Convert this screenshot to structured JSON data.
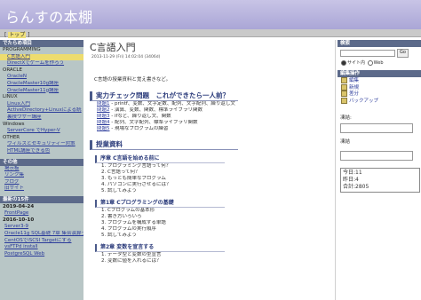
{
  "site": {
    "title": "らんすの本棚"
  },
  "topnav": {
    "home": "トップ"
  },
  "left": {
    "categories_head": "でたらめ項目",
    "categories": [
      {
        "label": "PROGRAMMING",
        "type": "cat"
      },
      {
        "label": "C言語入門",
        "type": "sub",
        "selected": true
      },
      {
        "label": "DirectXでゲームを作ろう",
        "type": "sub"
      },
      {
        "label": "ORACLE",
        "type": "cat"
      },
      {
        "label": "OracleN",
        "type": "sub"
      },
      {
        "label": "OracleMaster10g講座",
        "type": "sub"
      },
      {
        "label": "OracleMaster11g講座",
        "type": "sub"
      },
      {
        "label": "LINUX",
        "type": "cat"
      },
      {
        "label": "Linux入門",
        "type": "sub"
      },
      {
        "label": "ActiveDirectory+Linuxによる統",
        "type": "sub"
      },
      {
        "label": "裏技ワザー講座",
        "type": "sub"
      },
      {
        "label": "Windows",
        "type": "cat"
      },
      {
        "label": "ServerCore でHyper-V",
        "type": "sub"
      },
      {
        "label": "OTHER",
        "type": "cat"
      },
      {
        "label": "ウィルスとセキュリティー対策",
        "type": "sub"
      },
      {
        "label": "HTML講座できる色",
        "type": "sub"
      }
    ],
    "other_head": "その他",
    "other_links": [
      "掲示板",
      "リンク集",
      "ブログ",
      "旧サイト"
    ],
    "recent_head": "最新の15件",
    "recent": [
      {
        "date": "2019-04-24"
      },
      {
        "link": "FrontPage"
      },
      {
        "date": "2016-10-10"
      },
      {
        "link": "Server3-9"
      },
      {
        "link": "Oracle11g SQL基礎 7章 集合演算子の利用"
      },
      {
        "link": "CentOSでiSCSI Targetにする"
      },
      {
        "link": "vsFTPd install"
      },
      {
        "link": "PostgreSQL Web"
      }
    ]
  },
  "main": {
    "title": "C言語入門",
    "date": "2013-11-29 (Fri) 14:02:04 (3406d)",
    "intro": "C言語の授業資料と覚え書きなど。",
    "sections": [
      {
        "heading": "実力チェック問題　これができたら一人前？",
        "rows": [
          {
            "link": "問題1",
            "text": " - printf、変数、文字定数、配列、文字配列、繰り返し文"
          },
          {
            "link": "問題2",
            "text": " - 演算、変数、関数、標準ライブラリ関数"
          },
          {
            "link": "問題3",
            "text": " - ifなど、繰り返し文、関数"
          },
          {
            "link": "問題4",
            "text": " - 配列、文字配列、標準ライブラリ関数"
          },
          {
            "link": "問題5",
            "text": " - 現場なプログラムの練習"
          }
        ]
      },
      {
        "heading": "授業資料",
        "subsections": [
          {
            "heading": "序章 C言語を始める前に",
            "items": [
              "1. プログラミング言語って何？",
              "2. C言語って何？",
              "3. もっとも簡単なプログラム",
              "4. パソコンに実行させるには？",
              "5. 試してみよう"
            ]
          },
          {
            "heading": "第1章 Cプログラミングの基礎",
            "items": [
              "1. Cプログラムの基本形",
              "2. 書き方いろいろ",
              "3. プログラムを構成する単語",
              "4. プログラムの実行順序",
              "5. 試してみよう"
            ]
          },
          {
            "heading": "第2章 変数を宣言する",
            "items": [
              "1. データ型と変数の型宣言",
              "2. 変数に値を入れるには？"
            ]
          }
        ]
      }
    ]
  },
  "right": {
    "search_head": "検索",
    "search_placeholder": "",
    "search_button": "Go",
    "radio_site": "サイト内",
    "radio_web": "Web",
    "admin_head": "編集操作",
    "admin_items": [
      "編集",
      "新規",
      "差分",
      "バックアップ"
    ],
    "label_1": "凍結:",
    "label_2": "凍結",
    "counter": {
      "today": "今日:11",
      "yesterday": "昨日:4",
      "total": "合計:2805"
    }
  }
}
